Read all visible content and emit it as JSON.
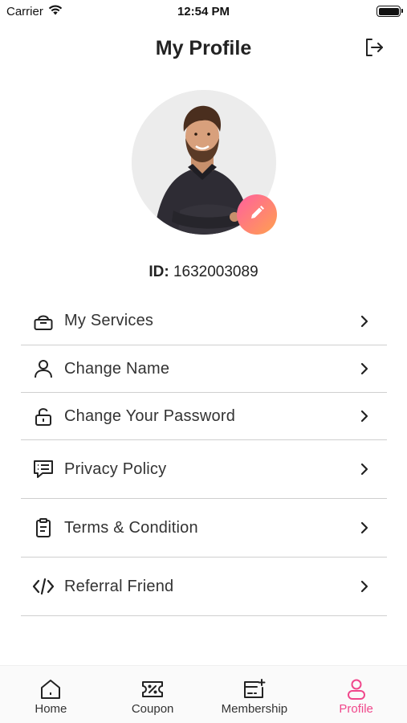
{
  "status_bar": {
    "carrier": "Carrier",
    "time": "12:54 PM"
  },
  "header": {
    "title": "My Profile",
    "logout_icon": "logout-icon"
  },
  "profile": {
    "id_label": "ID:",
    "id_value": "1632003089",
    "edit_icon": "pencil-icon"
  },
  "menu": [
    {
      "label": "My Services",
      "icon": "lock-box-icon"
    },
    {
      "label": "Change Name",
      "icon": "person-icon"
    },
    {
      "label": "Change Your Password",
      "icon": "padlock-icon"
    },
    {
      "label": "Privacy Policy",
      "icon": "message-list-icon"
    },
    {
      "label": "Terms & Condition",
      "icon": "clipboard-icon"
    },
    {
      "label": "Referral Friend",
      "icon": "code-icon"
    }
  ],
  "bottom_nav": [
    {
      "label": "Home",
      "icon": "home-icon"
    },
    {
      "label": "Coupon",
      "icon": "coupon-icon"
    },
    {
      "label": "Membership",
      "icon": "membership-card-icon"
    },
    {
      "label": "Profile",
      "icon": "profile-icon",
      "active": true
    }
  ],
  "colors": {
    "accent": "#f0478b",
    "gradient_start": "#ff5f9e",
    "gradient_end": "#ffa14f",
    "divider": "#cfcfcf"
  }
}
